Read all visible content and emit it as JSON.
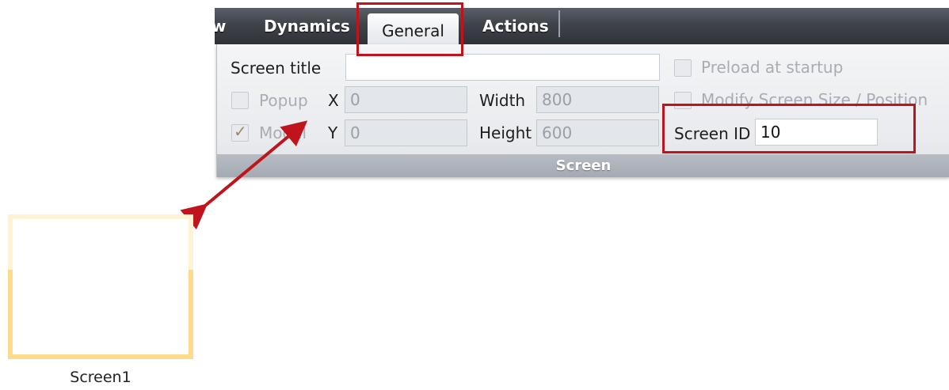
{
  "ribbon": {
    "tabs": [
      {
        "label": "w"
      },
      {
        "label": "Dynamics"
      },
      {
        "label": "General"
      },
      {
        "label": "Actions"
      }
    ],
    "active_tab": "General",
    "group_label": "Screen"
  },
  "screen_group": {
    "screen_title": {
      "label": "Screen title",
      "value": ""
    },
    "popup": {
      "label": "Popup",
      "checked": false
    },
    "modal": {
      "label": "Modal",
      "checked": true
    },
    "x": {
      "label": "X",
      "value": "0"
    },
    "y": {
      "label": "Y",
      "value": "0"
    },
    "width": {
      "label": "Width",
      "value": "800"
    },
    "height": {
      "label": "Height",
      "value": "600"
    },
    "preload": {
      "label": "Preload at startup",
      "checked": false
    },
    "modify_size": {
      "label": "Modify Screen Size / Position",
      "checked": false
    },
    "screen_id": {
      "label": "Screen ID",
      "value": "10"
    }
  },
  "thumbnail": {
    "caption": "Screen1"
  },
  "colors": {
    "annotation": "#c0141c",
    "thumbnail_border": "#ffd98c",
    "tabbar": "#3f434a"
  }
}
